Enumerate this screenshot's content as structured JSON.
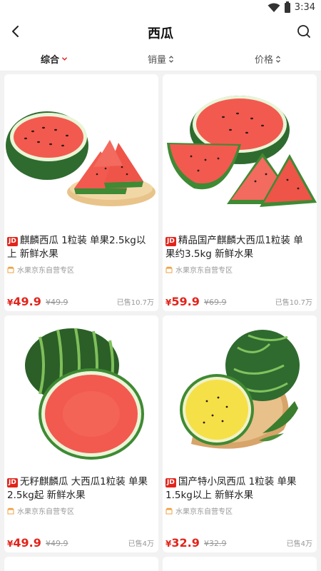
{
  "status_bar": {
    "time": "3:34"
  },
  "header": {
    "title": "西瓜"
  },
  "sort": {
    "items": [
      {
        "label": "综合"
      },
      {
        "label": "销量"
      },
      {
        "label": "价格"
      }
    ]
  },
  "products": [
    {
      "badge": "JD",
      "title": "麒麟西瓜 1粒装 单果2.5kg以上 新鲜水果",
      "store": "水果京东自营专区",
      "price": "49.9",
      "currency": "¥",
      "original_price": "¥49.9",
      "sold": "已售10.7万"
    },
    {
      "badge": "JD",
      "title": "精品国产麒麟大西瓜1粒装 单果约3.5kg 新鲜水果",
      "store": "水果京东自营专区",
      "price": "59.9",
      "currency": "¥",
      "original_price": "¥69.9",
      "sold": "已售10.7万"
    },
    {
      "badge": "JD",
      "title": "无籽麒麟瓜 大西瓜1粒装 单果2.5kg起 新鲜水果",
      "store": "水果京东自营专区",
      "price": "49.9",
      "currency": "¥",
      "original_price": "¥49.9",
      "sold": "已售4万"
    },
    {
      "badge": "JD",
      "title": "国产特小凤西瓜 1粒装 单果1.5kg以上 新鲜水果",
      "store": "水果京东自营专区",
      "price": "32.9",
      "currency": "¥",
      "original_price": "¥32.9",
      "sold": "已售4万"
    }
  ],
  "colors": {
    "accent": "#e1251b",
    "watermelon_red": "#f25a4f",
    "rind_green": "#2f6b2f",
    "yellow_flesh": "#f5e048"
  }
}
